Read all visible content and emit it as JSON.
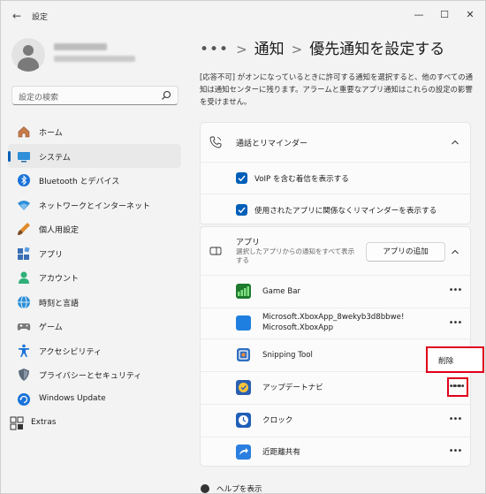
{
  "window": {
    "title": "設定",
    "back_glyph": "←",
    "minimize_glyph": "—",
    "maximize_glyph": "☐",
    "close_glyph": "✕"
  },
  "search": {
    "placeholder": "設定の検索"
  },
  "sidebar": {
    "items": [
      {
        "label": "ホーム",
        "icon": "home-icon"
      },
      {
        "label": "システム",
        "icon": "system-icon",
        "active": true
      },
      {
        "label": "Bluetooth とデバイス",
        "icon": "bluetooth-icon"
      },
      {
        "label": "ネットワークとインターネット",
        "icon": "network-icon"
      },
      {
        "label": "個人用設定",
        "icon": "personalization-icon"
      },
      {
        "label": "アプリ",
        "icon": "apps-icon"
      },
      {
        "label": "アカウント",
        "icon": "account-icon"
      },
      {
        "label": "時刻と言語",
        "icon": "time-language-icon"
      },
      {
        "label": "ゲーム",
        "icon": "gaming-icon"
      },
      {
        "label": "アクセシビリティ",
        "icon": "accessibility-icon"
      },
      {
        "label": "プライバシーとセキュリティ",
        "icon": "privacy-icon"
      },
      {
        "label": "Windows Update",
        "icon": "windows-update-icon"
      },
      {
        "label": "Extras",
        "icon": "extras-icon"
      }
    ]
  },
  "breadcrumb": {
    "more": "•••",
    "separator": ">",
    "parent": "通知",
    "current": "優先通知を設定する"
  },
  "description": "[応答不可] がオンになっているときに許可する通知を選択すると、他のすべての通知は通知センターに残ります。アラームと重要なアプリ通知はこれらの設定の影響を受けません。",
  "calls_card": {
    "title": "通話とリマインダー",
    "options": [
      {
        "label": "VoIP を含む着信を表示する",
        "checked": true
      },
      {
        "label": "使用されたアプリに関係なくリマインダーを表示する",
        "checked": true
      }
    ]
  },
  "apps_card": {
    "title": "アプリ",
    "subtitle": "選択したアプリからの通知をすべて表示する",
    "add_button": "アプリの追加",
    "apps": [
      {
        "label": "Game Bar",
        "icon": "game-bar-icon"
      },
      {
        "label": "Microsoft.XboxApp_8wekyb3d8bbwe!\nMicrosoft.XboxApp",
        "icon": "xbox-app-icon"
      },
      {
        "label": "Snipping Tool",
        "icon": "snipping-tool-icon"
      },
      {
        "label": "アップデートナビ",
        "icon": "update-navi-icon"
      },
      {
        "label": "クロック",
        "icon": "clock-icon"
      },
      {
        "label": "近距離共有",
        "icon": "nearby-share-icon"
      }
    ],
    "more_glyph": "•••"
  },
  "context_menu": {
    "remove_label": "削除"
  },
  "help": {
    "label": "ヘルプを表示"
  },
  "colors": {
    "accent": "#005fb8",
    "highlight": "#e0001a"
  }
}
